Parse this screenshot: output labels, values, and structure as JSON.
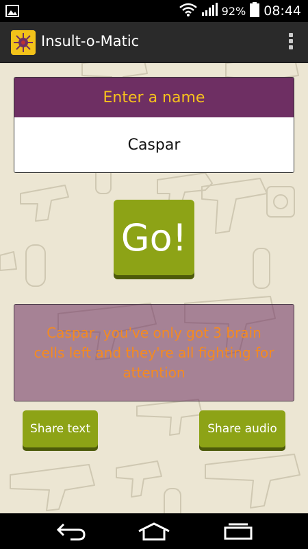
{
  "status_bar": {
    "battery_percent": "92%",
    "time": "08:44",
    "icons": [
      "image-notification-icon",
      "wifi-icon",
      "signal-icon",
      "battery-icon"
    ]
  },
  "action_bar": {
    "title": "Insult-o-Matic",
    "icons": [
      "app-logo-icon",
      "overflow-menu-icon"
    ]
  },
  "name_section": {
    "header": "Enter a name",
    "input_value": "Caspar"
  },
  "go_button": {
    "label": "Go!"
  },
  "insult": {
    "text": "Caspar, you've only got 3 brain cells left and they're all fighting for attention"
  },
  "share": {
    "text_label": "Share text",
    "audio_label": "Share audio"
  },
  "nav_bar": {
    "icons": [
      "back-icon",
      "home-icon",
      "recent-apps-icon"
    ]
  },
  "colors": {
    "accent_purple": "#6e2f63",
    "accent_yellow": "#f7c21d",
    "button_green": "#8da316",
    "insult_orange": "#f58a1f",
    "background_beige": "#ece6d3"
  }
}
